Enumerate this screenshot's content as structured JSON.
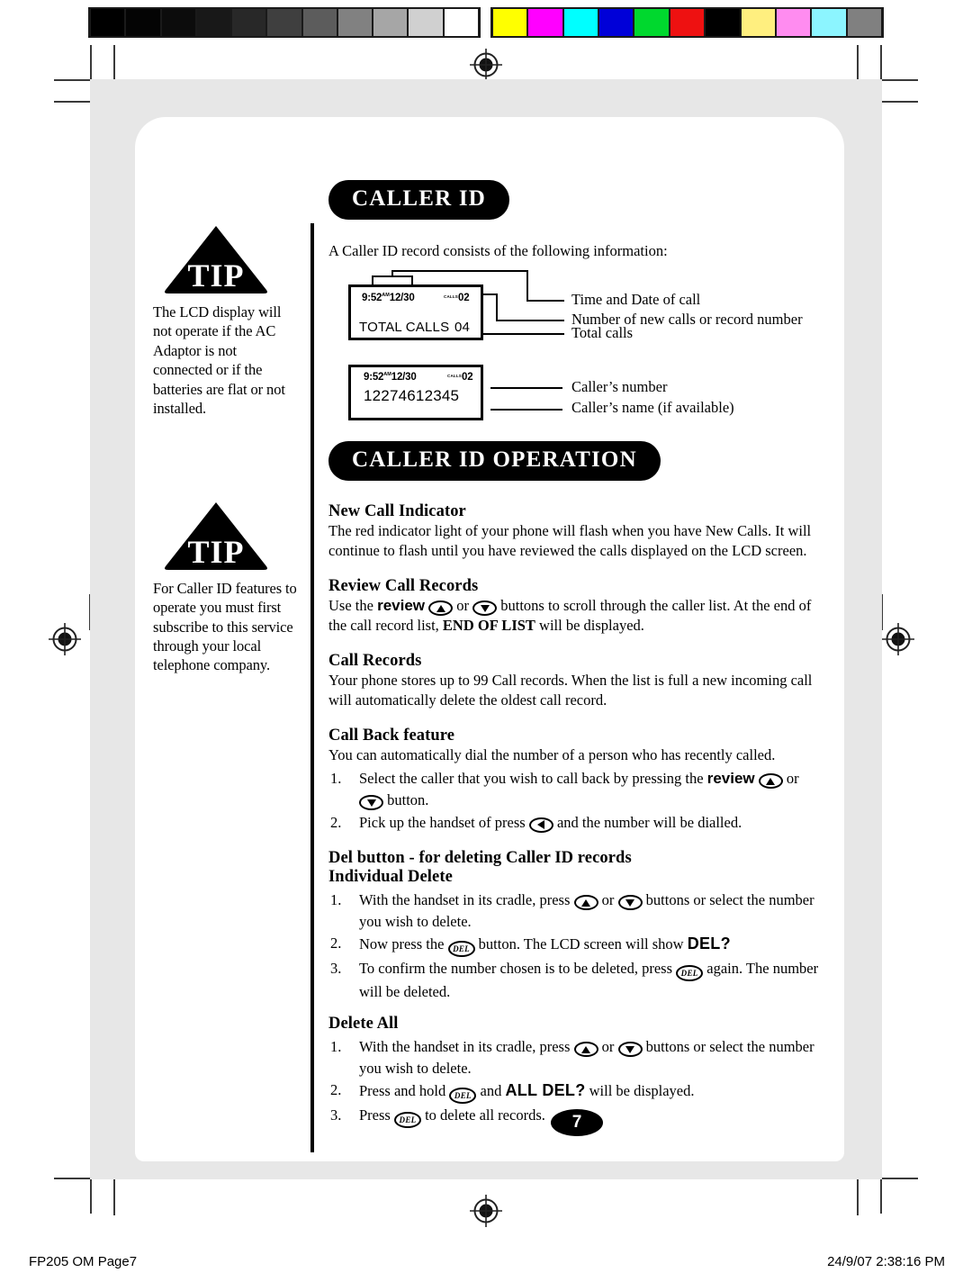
{
  "calibration": {
    "grayscale": [
      "#000000",
      "#040404",
      "#0c0c0c",
      "#181818",
      "#282828",
      "#3f3f3f",
      "#5c5c5c",
      "#818181",
      "#a6a6a6",
      "#d0d0d0",
      "#ffffff"
    ],
    "colors": [
      "#ffff00",
      "#ff00ff",
      "#00ffff",
      "#0000d8",
      "#00d82e",
      "#ee1111",
      "#000000",
      "#ffef7f",
      "#ff8cf0",
      "#8cf5ff",
      "#808080"
    ]
  },
  "sidebar": {
    "tips": [
      {
        "label": "TIP",
        "text": "The LCD display will not operate if the AC Adaptor is not connected or if the batteries are flat or not installed."
      },
      {
        "label": "TIP",
        "text": "For Caller ID features to operate you must first subscribe to this service through your local telephone company."
      }
    ]
  },
  "main": {
    "heading_caller_id": "CALLER ID",
    "intro": "A Caller ID  record consists of the following information:",
    "lcd_diagram": {
      "box1": {
        "time": "9:52",
        "ampm": "AM",
        "date": "12/30",
        "calls_label": "CALLS",
        "calls_value": "02",
        "bottom_label": "TOTAL CALLS",
        "bottom_value": "04"
      },
      "box2": {
        "time": "9:52",
        "ampm": "AM",
        "date": "12/30",
        "calls_label": "CALLS",
        "calls_value": "02",
        "number": "12274612345"
      },
      "callouts": [
        "Time and Date of call",
        "Number of new calls or record number",
        "Total calls",
        "Caller’s number",
        "Caller’s name (if available)"
      ]
    },
    "heading_operation": "CALLER ID OPERATION",
    "sections": {
      "new_call_indicator": {
        "title": "New Call Indicator",
        "body": "The red indicator light of your phone will flash when you have New Calls. It will continue to flash until you have reviewed the calls displayed on the LCD screen."
      },
      "review_call_records": {
        "title": "Review Call Records",
        "part1": "Use the",
        "kw_review": "review",
        "part2": "or",
        "part3": "buttons to scroll through the caller list. At the end of the call record list,",
        "kw_end_of_list": "END OF LIST",
        "part4": "will be displayed."
      },
      "call_records": {
        "title": "Call Records",
        "body": "Your phone stores up to 99 Call records. When the list is full a new incoming call will automatically delete the oldest call record."
      },
      "call_back": {
        "title": "Call Back feature",
        "body": "You can automatically dial the number of a person who has recently called.",
        "steps": [
          {
            "num": "1.",
            "part1": "Select the caller that you wish to call back by pressing the",
            "kw": "review",
            "part2": "or",
            "part3": "button."
          },
          {
            "num": "2.",
            "part1": "Pick up the handset of press",
            "part2": "and the number will be dialled."
          }
        ]
      },
      "del_button": {
        "title": "Del button - for deleting Caller ID records",
        "subtitle": "Individual Delete",
        "steps": [
          {
            "num": "1.",
            "part1": "With the handset in its cradle, press",
            "part2": "or",
            "part3": "buttons or select the number you wish to delete."
          },
          {
            "num": "2.",
            "part1": "Now press the",
            "part2": "button. The LCD screen will show",
            "lcd_word": "DEL?"
          },
          {
            "num": "3.",
            "part1": "To confirm the number chosen is to be deleted, press",
            "part2": "again. The number will be deleted."
          }
        ]
      },
      "delete_all": {
        "title": "Delete All",
        "steps": [
          {
            "num": "1.",
            "part1": "With the handset in its cradle, press",
            "part2": "or",
            "part3": "buttons or select the number you wish to delete."
          },
          {
            "num": "2.",
            "part1": "Press and hold",
            "part2": "and",
            "lcd_word": "ALL DEL?",
            "part3": "will be displayed."
          },
          {
            "num": "3.",
            "part1": "Press",
            "part2": "to delete all records."
          }
        ]
      }
    },
    "del_button_glyph": "DEL",
    "page_number": "7"
  },
  "footer": {
    "left": "FP205 OM  Page7",
    "right": "24/9/07  2:38:16 PM"
  }
}
